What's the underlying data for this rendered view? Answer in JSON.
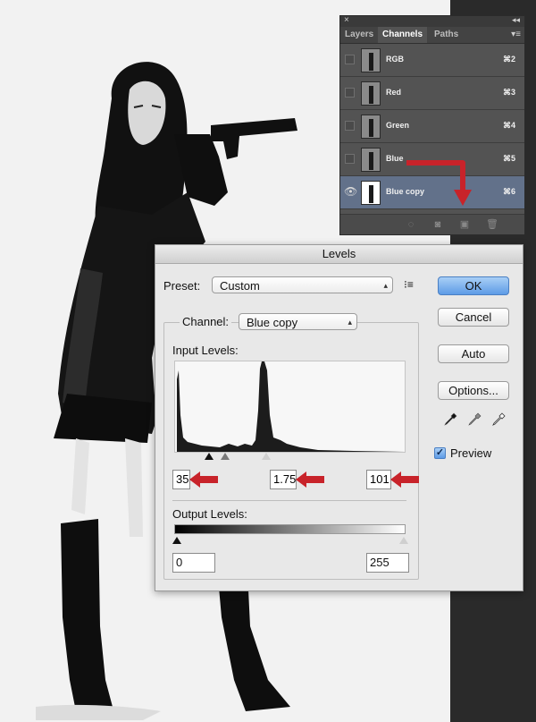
{
  "channels_panel": {
    "tabs": [
      "Layers",
      "Channels",
      "Paths"
    ],
    "active_tab": "Channels",
    "rows": [
      {
        "name": "RGB",
        "shortcut": "⌘2",
        "visible": false,
        "selected": false
      },
      {
        "name": "Red",
        "shortcut": "⌘3",
        "visible": false,
        "selected": false
      },
      {
        "name": "Green",
        "shortcut": "⌘4",
        "visible": false,
        "selected": false
      },
      {
        "name": "Blue",
        "shortcut": "⌘5",
        "visible": false,
        "selected": false
      },
      {
        "name": "Blue copy",
        "shortcut": "⌘6",
        "visible": true,
        "selected": true
      }
    ],
    "close_glyph": "×",
    "collapse_glyph": "◂◂",
    "menu_glyph": "▾≡"
  },
  "levels": {
    "title": "Levels",
    "preset_label": "Preset:",
    "preset_value": "Custom",
    "channel_label": "Channel:",
    "channel_value": "Blue copy",
    "input_levels_label": "Input Levels:",
    "input_black": "35",
    "input_gamma": "1.75",
    "input_white": "101",
    "output_levels_label": "Output Levels:",
    "output_black": "0",
    "output_white": "255",
    "buttons": {
      "ok": "OK",
      "cancel": "Cancel",
      "auto": "Auto",
      "options": "Options..."
    },
    "preview_label": "Preview",
    "preview_checked": true
  },
  "colors": {
    "annotation_arrow": "#c8232a",
    "selected_row": "#62718a",
    "ok_button": "#5d9be6"
  },
  "icons": {
    "preset_options": "preset-options-icon",
    "black_dropper": "black-eyedropper-icon",
    "gray_dropper": "gray-eyedropper-icon",
    "white_dropper": "white-eyedropper-icon",
    "eye": "eye-icon"
  }
}
